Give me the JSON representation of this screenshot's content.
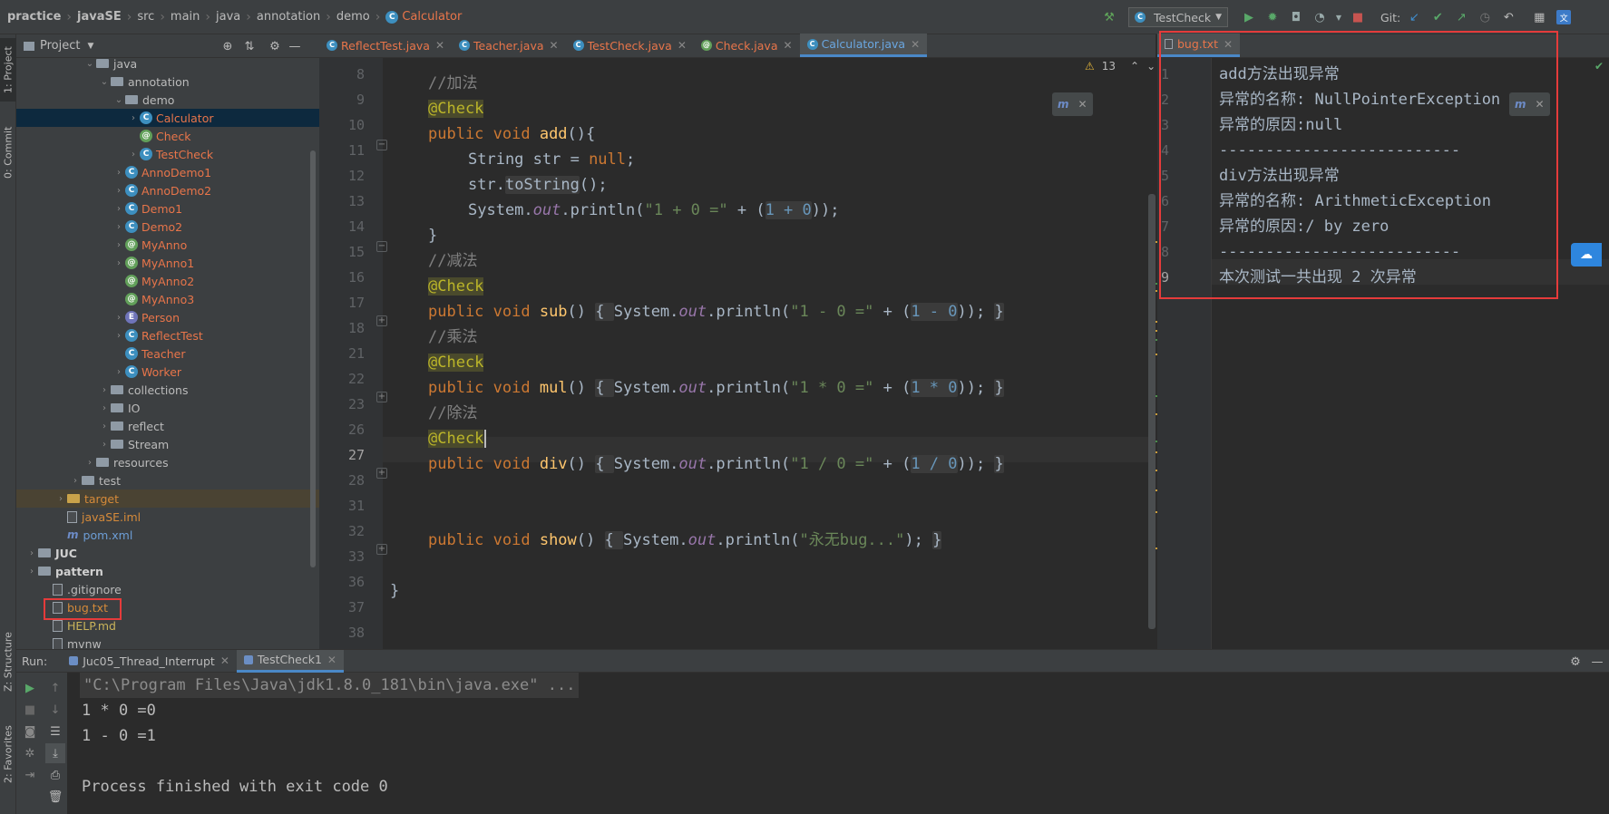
{
  "breadcrumb": {
    "items": [
      "practice",
      "javaSE",
      "src",
      "main",
      "java",
      "annotation",
      "demo",
      "Calculator"
    ]
  },
  "toolbar": {
    "run_config": "TestCheck",
    "git_label": "Git:"
  },
  "left_strip": {
    "project": "1: Project",
    "commit": "0: Commit",
    "structure": "Z: Structure",
    "favorites": "2: Favorites"
  },
  "project_panel": {
    "title": "Project"
  },
  "tree": [
    {
      "label": "java",
      "indent": 5,
      "type": "folder",
      "arrow": "▾"
    },
    {
      "label": "annotation",
      "indent": 6,
      "type": "folder",
      "arrow": "▾"
    },
    {
      "label": "demo",
      "indent": 7,
      "type": "folder",
      "arrow": "▾"
    },
    {
      "label": "Calculator",
      "indent": 8,
      "type": "class",
      "arrow": "›",
      "cls": "err",
      "selected": true
    },
    {
      "label": "Check",
      "indent": 8,
      "type": "anno",
      "arrow": "",
      "cls": "err"
    },
    {
      "label": "TestCheck",
      "indent": 8,
      "type": "class",
      "arrow": "›",
      "cls": "err"
    },
    {
      "label": "AnnoDemo1",
      "indent": 7,
      "type": "class",
      "arrow": "›",
      "cls": "err"
    },
    {
      "label": "AnnoDemo2",
      "indent": 7,
      "type": "class",
      "arrow": "›",
      "cls": "err"
    },
    {
      "label": "Demo1",
      "indent": 7,
      "type": "class",
      "arrow": "›",
      "cls": "err"
    },
    {
      "label": "Demo2",
      "indent": 7,
      "type": "class",
      "arrow": "›",
      "cls": "err"
    },
    {
      "label": "MyAnno",
      "indent": 7,
      "type": "anno",
      "arrow": "›",
      "cls": "err"
    },
    {
      "label": "MyAnno1",
      "indent": 7,
      "type": "anno",
      "arrow": "›",
      "cls": "err"
    },
    {
      "label": "MyAnno2",
      "indent": 7,
      "type": "anno",
      "arrow": "",
      "cls": "err"
    },
    {
      "label": "MyAnno3",
      "indent": 7,
      "type": "anno",
      "arrow": "",
      "cls": "err"
    },
    {
      "label": "Person",
      "indent": 7,
      "type": "enum",
      "arrow": "›",
      "cls": "err"
    },
    {
      "label": "ReflectTest",
      "indent": 7,
      "type": "class",
      "arrow": "›",
      "cls": "err"
    },
    {
      "label": "Teacher",
      "indent": 7,
      "type": "class",
      "arrow": "",
      "cls": "err"
    },
    {
      "label": "Worker",
      "indent": 7,
      "type": "class",
      "arrow": "›",
      "cls": "err"
    },
    {
      "label": "collections",
      "indent": 6,
      "type": "folder",
      "arrow": "›"
    },
    {
      "label": "IO",
      "indent": 6,
      "type": "folder",
      "arrow": "›"
    },
    {
      "label": "reflect",
      "indent": 6,
      "type": "folder",
      "arrow": "›"
    },
    {
      "label": "Stream",
      "indent": 6,
      "type": "folder",
      "arrow": "›"
    },
    {
      "label": "resources",
      "indent": 5,
      "type": "folder",
      "arrow": "›"
    },
    {
      "label": "test",
      "indent": 4,
      "type": "folder",
      "arrow": "›"
    },
    {
      "label": "target",
      "indent": 3,
      "type": "yfolder",
      "arrow": "›",
      "cls": "orange",
      "hl": true
    },
    {
      "label": "javaSE.iml",
      "indent": 3,
      "type": "file",
      "arrow": "",
      "cls": "orange"
    },
    {
      "label": "pom.xml",
      "indent": 3,
      "type": "mvn",
      "arrow": "",
      "cls": "blue"
    },
    {
      "label": "JUC",
      "indent": 1,
      "type": "folder",
      "arrow": "›",
      "cls": "bold"
    },
    {
      "label": "pattern",
      "indent": 1,
      "type": "folder",
      "arrow": "›",
      "cls": "bold"
    },
    {
      "label": ".gitignore",
      "indent": 2,
      "type": "file",
      "arrow": ""
    },
    {
      "label": "bug.txt",
      "indent": 2,
      "type": "file",
      "arrow": "",
      "cls": "orange"
    },
    {
      "label": "HELP.md",
      "indent": 2,
      "type": "file",
      "arrow": "",
      "cls": "yellow"
    },
    {
      "label": "mvnw",
      "indent": 2,
      "type": "file",
      "arrow": ""
    }
  ],
  "editor_tabs": [
    {
      "label": "ReflectTest.java",
      "icon": "C",
      "active": false
    },
    {
      "label": "Teacher.java",
      "icon": "C",
      "active": false
    },
    {
      "label": "TestCheck.java",
      "icon": "C",
      "active": false
    },
    {
      "label": "Check.java",
      "icon": "@",
      "active": false
    },
    {
      "label": "Calculator.java",
      "icon": "C",
      "active": true
    }
  ],
  "warnings": {
    "count": "13"
  },
  "line_numbers": [
    "8",
    "9",
    "10",
    "11",
    "12",
    "13",
    "14",
    "15",
    "16",
    "17",
    "18",
    "21",
    "22",
    "23",
    "26",
    "27",
    "28",
    "31",
    "32",
    "33",
    "36",
    "37",
    "38"
  ],
  "bug_tab": {
    "label": "bug.txt"
  },
  "bug_lines": [
    "add方法出现异常",
    "异常的名称: NullPointerException",
    "异常的原因:null",
    "--------------------------",
    "div方法出现异常",
    "异常的名称: ArithmeticException",
    "异常的原因:/ by zero",
    "--------------------------",
    "本次测试一共出现 2 次异常"
  ],
  "bug_line_numbers": [
    "1",
    "2",
    "3",
    "4",
    "5",
    "6",
    "7",
    "8",
    "9"
  ],
  "run": {
    "label": "Run:",
    "tabs": [
      "Juc05_Thread_Interrupt",
      "TestCheck1"
    ]
  },
  "console": {
    "cmd": "\"C:\\Program Files\\Java\\jdk1.8.0_181\\bin\\java.exe\" ...",
    "lines": [
      "1 * 0 =0",
      "1 - 0 =1"
    ],
    "exit": "Process finished with exit code 0"
  },
  "colors": {
    "highlight_box": "#e53b3b",
    "accent": "#4a88c7"
  }
}
